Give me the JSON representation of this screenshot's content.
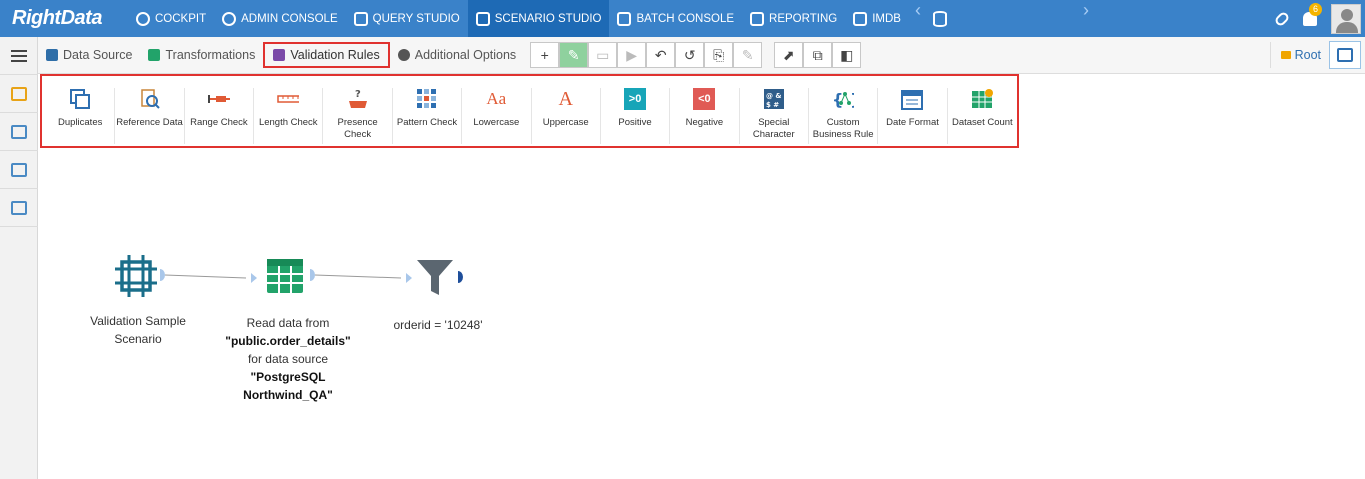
{
  "app": {
    "logo": "RightData"
  },
  "nav": [
    {
      "label": "COCKPIT"
    },
    {
      "label": "ADMIN CONSOLE"
    },
    {
      "label": "QUERY STUDIO"
    },
    {
      "label": "SCENARIO STUDIO"
    },
    {
      "label": "BATCH CONSOLE"
    },
    {
      "label": "REPORTING"
    },
    {
      "label": "IMDB"
    }
  ],
  "notifications": {
    "count": "6"
  },
  "toolbar": {
    "tabs": [
      {
        "label": "Data Source"
      },
      {
        "label": "Transformations"
      },
      {
        "label": "Validation Rules"
      },
      {
        "label": "Additional Options"
      }
    ],
    "root_label": "Root"
  },
  "rules": [
    {
      "label": "Duplicates"
    },
    {
      "label": "Reference Data"
    },
    {
      "label": "Range Check"
    },
    {
      "label": "Length Check"
    },
    {
      "label": "Presence Check"
    },
    {
      "label": "Pattern Check"
    },
    {
      "label": "Lowercase"
    },
    {
      "label": "Uppercase"
    },
    {
      "label": "Positive"
    },
    {
      "label": "Negative"
    },
    {
      "label": "Special Character"
    },
    {
      "label": "Custom Business Rule"
    },
    {
      "label": "Date Format"
    },
    {
      "label": "Dataset Count"
    }
  ],
  "rule_icon_text": {
    "positive": ">0",
    "negative": "<0",
    "lowercase": "Aa",
    "uppercase": "A"
  },
  "nodes": {
    "scenario": {
      "line1": "Validation Sample",
      "line2": "Scenario"
    },
    "read": {
      "line1": "Read data from",
      "table": "\"public.order_details\"",
      "line3": "for data source",
      "source1": "\"PostgreSQL",
      "source2": "Northwind_QA\""
    },
    "filter": {
      "label": "orderid = '10248'"
    }
  },
  "colors": {
    "topbar": "#3a82c9",
    "highlight": "#e0322f",
    "node_teal": "#1a6e8a",
    "node_green": "#22a36a",
    "node_gray": "#5b6670"
  }
}
